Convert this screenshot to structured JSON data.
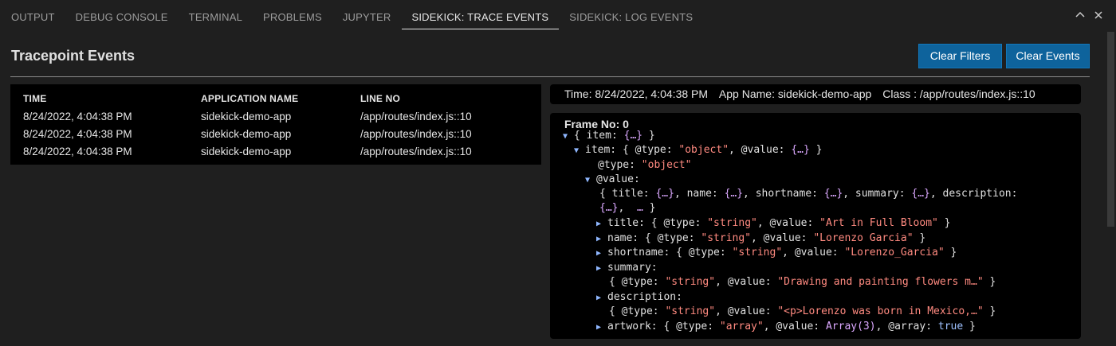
{
  "tabs": [
    "OUTPUT",
    "DEBUG CONSOLE",
    "TERMINAL",
    "PROBLEMS",
    "JUPYTER",
    "SIDEKICK: TRACE EVENTS",
    "SIDEKICK: LOG EVENTS"
  ],
  "active_tab": "SIDEKICK: TRACE EVENTS",
  "panel": {
    "title": "Tracepoint Events",
    "clear_filters_label": "Clear Filters",
    "clear_events_label": "Clear Events"
  },
  "table": {
    "columns": [
      "TIME",
      "APPLICATION NAME",
      "LINE NO"
    ],
    "rows": [
      [
        "8/24/2022, 4:04:38 PM",
        "sidekick-demo-app",
        "/app/routes/index.js::10"
      ],
      [
        "8/24/2022, 4:04:38 PM",
        "sidekick-demo-app",
        "/app/routes/index.js::10"
      ],
      [
        "8/24/2022, 4:04:38 PM",
        "sidekick-demo-app",
        "/app/routes/index.js::10"
      ]
    ]
  },
  "detail": {
    "time": "Time: 8/24/2022, 4:04:38 PM",
    "app_name": "App Name: sidekick-demo-app",
    "class": "Class : /app/routes/index.js::10",
    "frame_title": "Frame No: 0"
  },
  "tree_lines": [
    "{ item: {…} }",
    "item: { @type: \"object\", @value: {…} }",
    "@type: \"object\"",
    "@value:",
    "{ title: {…}, name: {…}, shortname: {…}, summary: {…}, description:",
    "{…},  … }",
    "title: { @type: \"string\", @value: \"Art in Full Bloom\" }",
    "name: { @type: \"string\", @value: \"Lorenzo Garcia\" }",
    "shortname: { @type: \"string\", @value: \"Lorenzo_Garcia\" }",
    "summary:",
    "{ @type: \"string\", @value: \"Drawing and painting flowers m…\" }",
    "description:",
    "{ @type: \"string\", @value: \"<p>Lorenzo was born in Mexico,…\" }",
    "artwork: { @type: \"array\", @value: Array(3), @array: true }"
  ],
  "icons": {
    "collapse": "chevron-up-icon",
    "close": "close-icon",
    "expanded": "triangle-down-icon",
    "collapsed": "triangle-right-icon"
  },
  "colors": {
    "button_bg": "#0e639c",
    "string_value": "#ff8a80",
    "collapsed_value": "#dba8ff"
  }
}
